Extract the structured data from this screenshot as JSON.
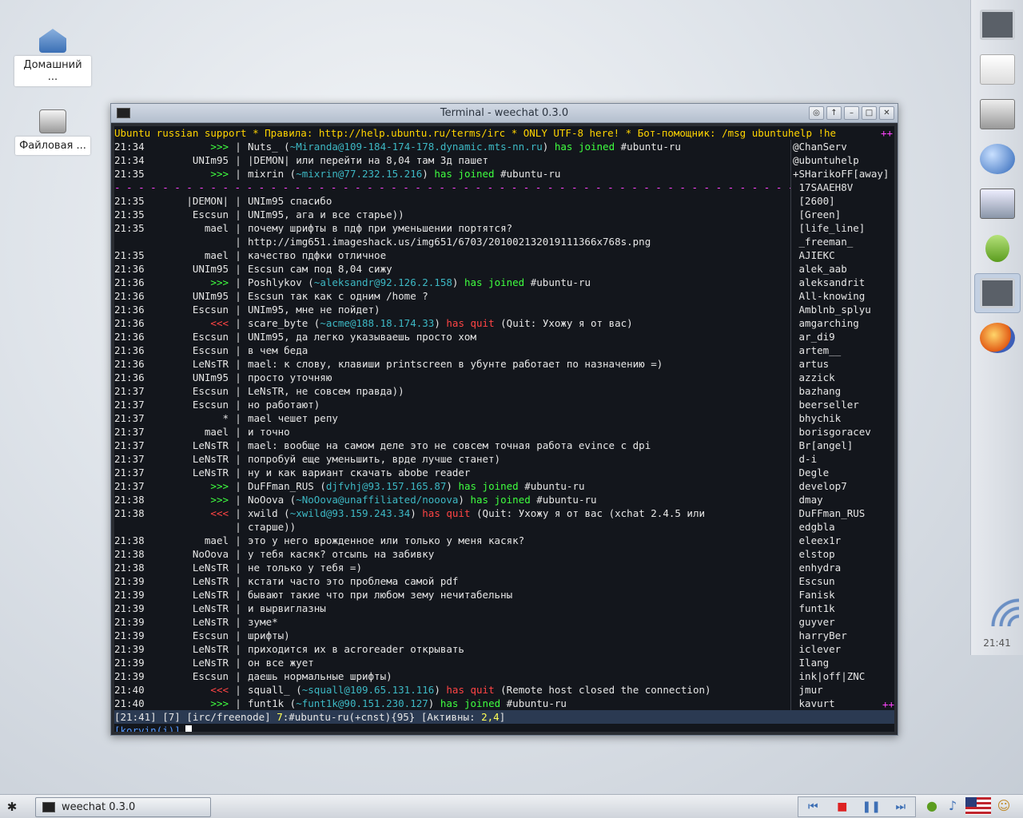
{
  "desktop": {
    "icons": [
      {
        "label": "Домашний ..."
      },
      {
        "label": "Файловая ..."
      }
    ]
  },
  "window": {
    "title": "Terminal - weechat 0.3.0",
    "buttons": [
      "◎",
      "↑",
      "–",
      "□",
      "✕"
    ]
  },
  "weechat": {
    "topic": "Ubuntu russian support * Правила: http://help.ubuntu.ru/terms/irc * ONLY UTF-8 here! * Бот-помощник: /msg ubuntuhelp !he",
    "topic_more": "++",
    "lines": [
      {
        "time": "21:34",
        "nick": ">>>",
        "kind": "join",
        "who": "Nuts_",
        "host": "~Miranda@109-184-174-178.dynamic.mts-nn.ru",
        "act": "has joined",
        "chan": "#ubuntu-ru"
      },
      {
        "time": "21:34",
        "nick": "UNIm95",
        "kind": "msg",
        "text": "|DEMON| или перейти на 8,04 там 3д пашет"
      },
      {
        "time": "21:35",
        "nick": ">>>",
        "kind": "join",
        "who": "mixrin",
        "host": "~mixrin@77.232.15.216",
        "act": "has joined",
        "chan": "#ubuntu-ru"
      },
      {
        "kind": "divider",
        "text": "- - - - - - - - - - - - - - - - - - - - - - - - - - - - - - - - - - - - - - - - - - - - - - - - - - - - - - - - - - - - - - - - - - - - - - - - -"
      },
      {
        "time": "21:35",
        "nick": "|DEMON|",
        "kind": "msg",
        "text": "UNIm95 спасибо"
      },
      {
        "time": "21:35",
        "nick": "Escsun",
        "kind": "msg",
        "text": "UNIm95, ага и все старье))"
      },
      {
        "time": "21:35",
        "nick": "mael",
        "kind": "msg",
        "text": "почему шрифты в пдф при уменьшении портятся?"
      },
      {
        "time": "",
        "nick": "",
        "kind": "msg",
        "text": "http://img651.imageshack.us/img651/6703/201002132019111366x768s.png"
      },
      {
        "time": "21:35",
        "nick": "mael",
        "kind": "msg",
        "text": "качество пдфки отличное"
      },
      {
        "time": "21:36",
        "nick": "UNIm95",
        "kind": "msg",
        "text": "Escsun сам под 8,04 сижу"
      },
      {
        "time": "21:36",
        "nick": ">>>",
        "kind": "join",
        "who": "Poshlykov",
        "host": "~aleksandr@92.126.2.158",
        "act": "has joined",
        "chan": "#ubuntu-ru"
      },
      {
        "time": "21:36",
        "nick": "UNIm95",
        "kind": "msg",
        "text": "Escsun так как с одним /home ?"
      },
      {
        "time": "21:36",
        "nick": "Escsun",
        "kind": "msg",
        "text": "UNIm95, мне не пойдет)"
      },
      {
        "time": "21:36",
        "nick": "<<<",
        "kind": "quit",
        "who": "scare_byte",
        "host": "~acme@188.18.174.33",
        "act": "has quit",
        "reason": "(Quit: Ухожу я от вас)"
      },
      {
        "time": "21:36",
        "nick": "Escsun",
        "kind": "msg",
        "text": "UNIm95, да легко указываешь просто хом"
      },
      {
        "time": "21:36",
        "nick": "Escsun",
        "kind": "msg",
        "text": "в чем беда"
      },
      {
        "time": "21:36",
        "nick": "LeNsTR",
        "kind": "msg",
        "text": "mael: к слову, клавиши printscreen в убунте работает по назначению =)"
      },
      {
        "time": "21:36",
        "nick": "UNIm95",
        "kind": "msg",
        "text": "просто уточняю"
      },
      {
        "time": "21:37",
        "nick": "Escsun",
        "kind": "msg",
        "text": "LeNsTR, не совсем правда))"
      },
      {
        "time": "21:37",
        "nick": "Escsun",
        "kind": "msg",
        "text": "но работают)"
      },
      {
        "time": "21:37",
        "nick": "*",
        "kind": "msg",
        "text": "mael чешет репу"
      },
      {
        "time": "21:37",
        "nick": "mael",
        "kind": "msg",
        "text": "и точно"
      },
      {
        "time": "21:37",
        "nick": "LeNsTR",
        "kind": "msg",
        "text": "mael: вообще на самом деле это не совсем точная работа evince с dpi"
      },
      {
        "time": "21:37",
        "nick": "LeNsTR",
        "kind": "msg",
        "text": "попробуй еще уменьшить, врде лучше станет)"
      },
      {
        "time": "21:37",
        "nick": "LeNsTR",
        "kind": "msg",
        "text": "ну и как вариант скачать abobe reader"
      },
      {
        "time": "21:37",
        "nick": ">>>",
        "kind": "join",
        "who": "DuFFman_RUS",
        "host": "djfvhj@93.157.165.87",
        "act": "has joined",
        "chan": "#ubuntu-ru"
      },
      {
        "time": "21:38",
        "nick": ">>>",
        "kind": "join",
        "who": "NoOova",
        "host": "~NoOova@unaffiliated/nooova",
        "act": "has joined",
        "chan": "#ubuntu-ru"
      },
      {
        "time": "21:38",
        "nick": "<<<",
        "kind": "quit",
        "who": "xwild",
        "host": "~xwild@93.159.243.34",
        "act": "has quit",
        "reason": "(Quit: Ухожу я от вас (xchat 2.4.5 или"
      },
      {
        "time": "",
        "nick": "",
        "kind": "msg",
        "text": "старше))"
      },
      {
        "time": "21:38",
        "nick": "mael",
        "kind": "msg",
        "text": "это у него врожденное или только у меня касяк?"
      },
      {
        "time": "21:38",
        "nick": "NoOova",
        "kind": "msg",
        "text": "у тебя касяк? отсыпь на забивку"
      },
      {
        "time": "21:38",
        "nick": "LeNsTR",
        "kind": "msg",
        "text": "не только у тебя =)"
      },
      {
        "time": "21:39",
        "nick": "LeNsTR",
        "kind": "msg",
        "text": "кстати часто это проблема самой pdf"
      },
      {
        "time": "21:39",
        "nick": "LeNsTR",
        "kind": "msg",
        "text": "бывают такие что при любом зему нечитабельны"
      },
      {
        "time": "21:39",
        "nick": "LeNsTR",
        "kind": "msg",
        "text": "и вырвиглазны"
      },
      {
        "time": "21:39",
        "nick": "LeNsTR",
        "kind": "msg",
        "text": "зуме*"
      },
      {
        "time": "21:39",
        "nick": "Escsun",
        "kind": "msg",
        "text": "шрифты)"
      },
      {
        "time": "21:39",
        "nick": "LeNsTR",
        "kind": "msg",
        "text": "приходится их в acroreader открывать"
      },
      {
        "time": "21:39",
        "nick": "LeNsTR",
        "kind": "msg",
        "text": "он все жует"
      },
      {
        "time": "21:39",
        "nick": "Escsun",
        "kind": "msg",
        "text": "даешь нормальные шрифты)"
      },
      {
        "time": "21:40",
        "nick": "<<<",
        "kind": "quit",
        "who": "squall_",
        "host": "~squall@109.65.131.116",
        "act": "has quit",
        "reason": "(Remote host closed the connection)"
      },
      {
        "time": "21:40",
        "nick": ">>>",
        "kind": "join",
        "who": "funt1k",
        "host": "~funt1k@90.151.230.127",
        "act": "has joined",
        "chan": "#ubuntu-ru"
      }
    ],
    "nicklist": [
      "@ChanServ",
      "@ubuntuhelp",
      "+SHarikoFF[away]",
      " 17SAAEH8V",
      " [2600]",
      " [Green]",
      " [life_line]",
      " _freeman_",
      " AJIEKC",
      " alek_aab",
      " aleksandrit",
      " All-knowing",
      " Amblnb_splyu",
      " amgarching",
      " ar_di9",
      " artem__",
      " artus",
      " azzick",
      " bazhang",
      " beerseller",
      " bhychik",
      " borisgoracev",
      " Br[angel]",
      " d-i",
      " Degle",
      " develop7",
      " dmay",
      " DuFFman_RUS",
      " edgbla",
      " eleex1r",
      " elstop",
      " enhydra",
      " Escsun",
      " Fanisk",
      " funt1k",
      " guyver",
      " harryBer",
      " iclever",
      " Ilang",
      " ink|off|ZNC",
      " jmur",
      " kavurt"
    ],
    "nicklist_more": "++",
    "status": {
      "time": "[21:41]",
      "count": "[7]",
      "server": "[irc/freenode]",
      "buffer_num": "7",
      "channel": ":#ubuntu-ru(+cnst){95}",
      "active_label": "[Активны: ",
      "active_nums": "2,4",
      "active_close": "]"
    },
    "input_prompt": "[korvin(i)]"
  },
  "dock": {
    "items": [
      "terminal-icon",
      "text-editor-icon",
      "archive-icon",
      "browser-globe-icon",
      "window-switcher-icon",
      "user-icon",
      "terminal-task-icon",
      "firefox-icon"
    ],
    "clock": "21:41"
  },
  "taskbar": {
    "task_label": "weechat 0.3.0",
    "media": [
      "⏮",
      "■",
      "❚❚",
      "⏭"
    ],
    "tray": [
      "network-icon",
      "music-icon",
      "us-flag-icon",
      "user-switch-icon"
    ]
  }
}
